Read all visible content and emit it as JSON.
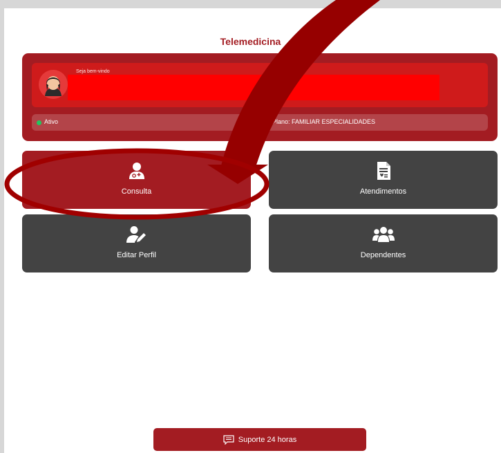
{
  "header": {
    "title": "Telemedicina"
  },
  "user_card": {
    "greeting": "Seja bem-vindo",
    "status": "Ativo",
    "plan": "Plano: FAMILIAR ESPECIALIDADES"
  },
  "tiles": [
    {
      "label": "Consulta",
      "icon": "doctor-icon"
    },
    {
      "label": "Atendimentos",
      "icon": "medical-record-icon"
    },
    {
      "label": "Editar Perfil",
      "icon": "edit-user-icon"
    },
    {
      "label": "Dependentes",
      "icon": "users-icon"
    }
  ],
  "support": {
    "label": "Suporte 24 horas",
    "icon": "chat-icon"
  },
  "colors": {
    "brand": "#a31c22",
    "tile": "#434343",
    "status_active": "#22c55e",
    "redaction": "#ff0000"
  }
}
